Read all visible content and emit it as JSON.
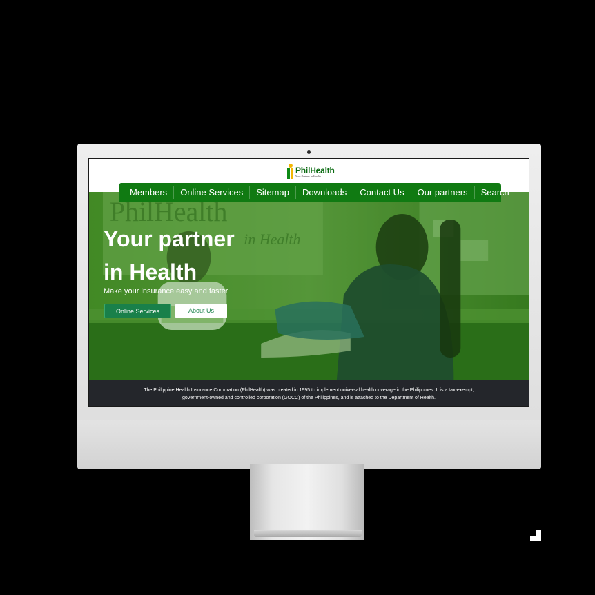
{
  "brand": {
    "name": "PhilHealth",
    "tagline": "Your Partner in Health",
    "colors": {
      "primary": "#107a12",
      "accent": "#f2b705",
      "footer": "#24262b"
    }
  },
  "nav": {
    "items": [
      {
        "label": "Members"
      },
      {
        "label": "Online Services"
      },
      {
        "label": "Sitemap"
      },
      {
        "label": "Downloads"
      },
      {
        "label": "Contact Us"
      },
      {
        "label": "Our partners"
      },
      {
        "label": "Search"
      }
    ]
  },
  "hero": {
    "title_line1": "Your partner",
    "title_line2": "in Health",
    "subtitle": "Make your insurance easy and faster",
    "primary_button": "Online Services",
    "secondary_button": "About Us"
  },
  "footer": {
    "text": "The Philippine Health Insurance Corporation (PhilHealth) was created in 1995 to implement universal health coverage in the Philippines. It is a tax-exempt, government-owned and controlled corporation (GOCC) of the Philippines, and is attached to the Department of Health."
  }
}
